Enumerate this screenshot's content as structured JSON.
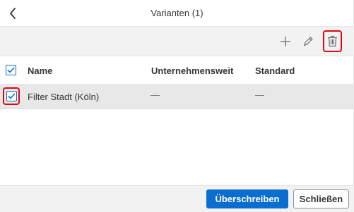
{
  "dialog": {
    "title": "Varianten (1)"
  },
  "toolbar": {
    "icons": [
      "add-icon",
      "edit-icon",
      "delete-icon"
    ]
  },
  "table": {
    "columns": [
      "Name",
      "Unternehmensweit",
      "Standard"
    ],
    "rows": [
      {
        "name": "Filter Stadt (Köln)",
        "corporate": "—",
        "standard": "—",
        "checked": true
      }
    ],
    "select_all_checked": true
  },
  "footer": {
    "primary_label": "Überschreiben",
    "secondary_label": "Schließen"
  },
  "colors": {
    "accent": "#0a6ed1",
    "highlight": "#e30613",
    "toolbar_bg": "#f2f2f2",
    "selected_row_bg": "#e8e8e8"
  }
}
